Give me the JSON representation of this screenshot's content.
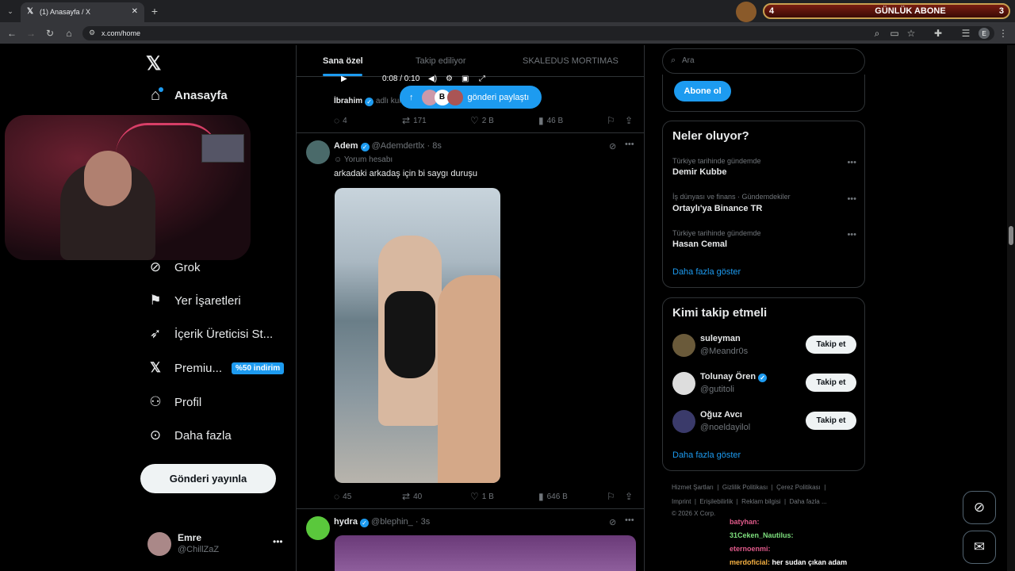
{
  "browser": {
    "tab_title": "(1) Anasayfa / X",
    "url": "x.com/home",
    "profile_letter": "E"
  },
  "banner": {
    "left": "4",
    "text": "GÜNLÜK ABONE",
    "right": "3"
  },
  "nav": {
    "home": "Anasayfa",
    "grok": "Grok",
    "bookmarks": "Yer İşaretleri",
    "creator": "İçerik Üreticisi St...",
    "premium": "Premiu...",
    "premium_badge": "%50 indirim",
    "profile": "Profil",
    "more": "Daha fazla",
    "post_button": "Gönderi yayınla"
  },
  "account": {
    "name": "Emre",
    "handle": "@ChillZaZ"
  },
  "tabs": [
    "Sana özel",
    "Takip ediliyor",
    "SKALEDUS MORTIMAS"
  ],
  "video_controls": {
    "time": "0:08 / 0:10"
  },
  "share_pill": {
    "avatar_letter": "B",
    "label": "gönderi paylaştı"
  },
  "post0": {
    "author_partial": "İbrahim",
    "text_partial": "adlı kul",
    "replies": "4",
    "reposts": "171",
    "likes": "2 B",
    "views": "46 B"
  },
  "post1": {
    "name": "Adem",
    "handle": "@Ademdertlx",
    "time": "8s",
    "label": "Yorum hesabı",
    "text": "arkadaki arkadaş için bi saygı duruşu",
    "replies": "45",
    "reposts": "40",
    "likes": "1 B",
    "views": "646 B"
  },
  "post2": {
    "name": "hydra",
    "handle": "@blephin_",
    "time": "3s"
  },
  "search": {
    "placeholder": "Ara"
  },
  "subscribe_button": "Abone ol",
  "trends": {
    "title": "Neler oluyor?",
    "items": [
      {
        "meta": "Türkiye tarihinde gündemde",
        "name": "Demir Kubbe"
      },
      {
        "meta": "İş dünyası ve finans · Gündemdekiler",
        "name": "Ortaylı'ya Binance TR"
      },
      {
        "meta": "Türkiye tarihinde gündemde",
        "name": "Hasan Cemal"
      }
    ],
    "show_more": "Daha fazla göster"
  },
  "who_to_follow": {
    "title": "Kimi takip etmeli",
    "items": [
      {
        "name": "suleyman",
        "handle": "@Meandr0s",
        "button": "Takip et"
      },
      {
        "name": "Tolunay Ören",
        "handle": "@gutitoli",
        "button": "Takip et"
      },
      {
        "name": "Oğuz Avcı",
        "handle": "@noeldayilol",
        "button": "Takip et"
      }
    ],
    "show_more": "Daha fazla göster"
  },
  "footer": {
    "line1": "Hizmet Şartları  |  Gizlilik Politikası  |  Çerez Politikası  |",
    "line2": "Imprint  |  Erişilebilirlik  |  Reklam bilgisi  |  Daha fazla ...",
    "line3": "© 2026 X Corp."
  },
  "chat": [
    {
      "user": "batyhan:",
      "msg": "",
      "color": "#e05a8a"
    },
    {
      "user": "31Ceken_Nautilus:",
      "msg": "",
      "color": "#7ee07e"
    },
    {
      "user": "eternoenmi:",
      "msg": "",
      "color": "#e05a8a"
    },
    {
      "user": "merdoficial:",
      "msg": "her sudan çıkan adam",
      "color": "#f5b041"
    }
  ],
  "colors": {
    "accent": "#1d9bf0",
    "background": "#000000",
    "border": "#2f3336",
    "muted": "#71767b"
  }
}
